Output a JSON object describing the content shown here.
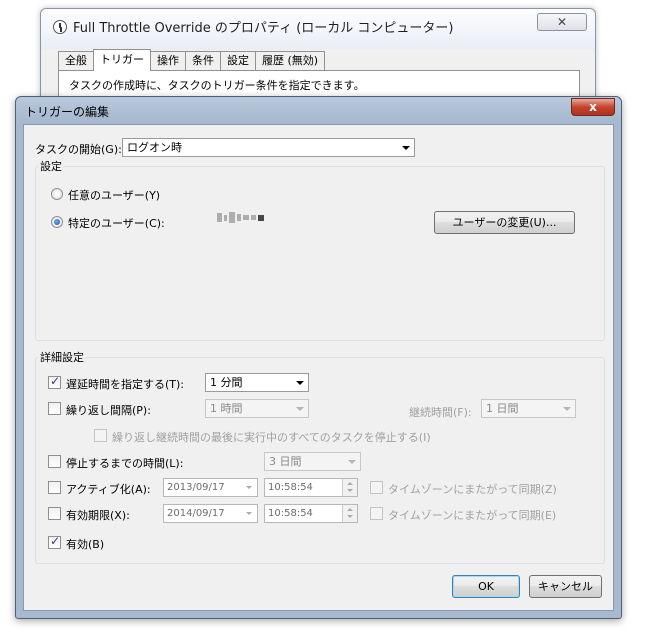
{
  "background_window": {
    "title": "Full Throttle Override のプロパティ (ローカル コンピューター)",
    "close_label": "✕",
    "tabs": [
      {
        "label": "全般"
      },
      {
        "label": "トリガー"
      },
      {
        "label": "操作"
      },
      {
        "label": "条件"
      },
      {
        "label": "設定"
      },
      {
        "label": "履歴 (無効)"
      }
    ],
    "tab_description": "タスクの作成時に、タスクのトリガー条件を指定できます。"
  },
  "dialog": {
    "title": "トリガーの編集",
    "close_label": "x",
    "start_task_label": "タスクの開始(G):",
    "start_task_value": "ログオン時",
    "settings_group": {
      "title": "設定",
      "any_user_label": "任意のユーザー(Y)",
      "specific_user_label": "特定のユーザー(C):",
      "change_user_button": "ユーザーの変更(U)..."
    },
    "advanced_group": {
      "title": "詳細設定",
      "delay_label": "遅延時間を指定する(T):",
      "delay_value": "1 分間",
      "delay_checked": true,
      "repeat_label": "繰り返し間隔(P):",
      "repeat_value": "1 時間",
      "repeat_checked": false,
      "duration_label": "継続時間(F):",
      "duration_value": "1 日間",
      "stop_running_label": "繰り返し継続時間の最後に実行中のすべてのタスクを停止する(I)",
      "stop_after_label": "停止するまでの時間(L):",
      "stop_after_value": "3 日間",
      "stop_after_checked": false,
      "activate_label": "アクティブ化(A):",
      "activate_date": "2013/09/17",
      "activate_time": "10:58:54",
      "activate_checked": false,
      "activate_sync_label": "タイムゾーンにまたがって同期(Z)",
      "expire_label": "有効期限(X):",
      "expire_date": "2014/09/17",
      "expire_time": "10:58:54",
      "expire_checked": false,
      "expire_sync_label": "タイムゾーンにまたがって同期(E)",
      "enabled_label": "有効(B)",
      "enabled_checked": true
    },
    "ok_button": "OK",
    "cancel_button": "キャンセル"
  }
}
